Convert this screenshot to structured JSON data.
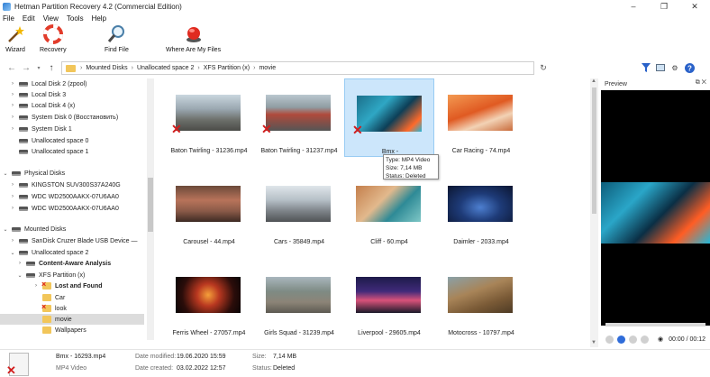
{
  "window": {
    "title": "Hetman Partition Recovery 4.2 (Commercial Edition)"
  },
  "menu": [
    "File",
    "Edit",
    "View",
    "Tools",
    "Help"
  ],
  "toolbar": {
    "wizard": "Wizard",
    "recovery": "Recovery",
    "find_file": "Find File",
    "where": "Where Are My Files"
  },
  "breadcrumb": [
    "Mounted Disks",
    "Unallocated space 2",
    "XFS Partition (x)",
    "movie"
  ],
  "tree": [
    {
      "label": "Local Disk 2 (zpool)"
    },
    {
      "label": "Local Disk 3"
    },
    {
      "label": "Local Disk 4 (x)"
    },
    {
      "label": "System Disk 0 (Восстановить)"
    },
    {
      "label": "System Disk 1"
    },
    {
      "label": "Unallocated space 0"
    },
    {
      "label": "Unallocated space 1"
    },
    {
      "label": "Physical Disks"
    },
    {
      "label": "KINGSTON SUV300S37A240G"
    },
    {
      "label": "WDC WD2500AAKX-07U6AA0"
    },
    {
      "label": "WDC WD2500AAKX-07U6AA0"
    },
    {
      "label": "Mounted Disks"
    },
    {
      "label": "SanDisk Cruzer Blade USB Device —"
    },
    {
      "label": "Unallocated space 2"
    },
    {
      "label": "Content-Aware Analysis"
    },
    {
      "label": "XFS Partition (x)"
    },
    {
      "label": "Lost and Found"
    },
    {
      "label": "Car"
    },
    {
      "label": "look"
    },
    {
      "label": "movie"
    },
    {
      "label": "Wallpapers"
    }
  ],
  "files": [
    {
      "name": "Baton Twirling - 31236.mp4",
      "deleted": true
    },
    {
      "name": "Baton Twirling - 31237.mp4",
      "deleted": true
    },
    {
      "name": "Bmx - 16293.mp4",
      "deleted": true
    },
    {
      "name": "Car Racing - 74.mp4",
      "deleted": false
    },
    {
      "name": "Carousel - 44.mp4",
      "deleted": false
    },
    {
      "name": "Cars - 35849.mp4",
      "deleted": false
    },
    {
      "name": "Cliff - 60.mp4",
      "deleted": false
    },
    {
      "name": "Daimler - 2033.mp4",
      "deleted": false
    },
    {
      "name": "Ferris Wheel - 27057.mp4",
      "deleted": false
    },
    {
      "name": "Girls Squad - 31239.mp4",
      "deleted": false
    },
    {
      "name": "Liverpool - 29605.mp4",
      "deleted": false
    },
    {
      "name": "Motocross - 10797.mp4",
      "deleted": false
    }
  ],
  "selected_caption": "Bmx -",
  "tooltip": {
    "type": "Type: MP4 Video",
    "size": "Size: 7,14 MB",
    "status": "Status: Deleted"
  },
  "preview": {
    "title": "Preview",
    "time": "00:00 / 00:12"
  },
  "status": {
    "name": "Bmx - 16293.mp4",
    "kind": "MP4 Video",
    "modified_label": "Date modified:",
    "modified": "19.06.2020 15:59",
    "created_label": "Date created:",
    "created": "03.02.2022 12:57",
    "size_label": "Size:",
    "size": "7,14 MB",
    "status_label": "Status:",
    "status_value": "Deleted"
  }
}
